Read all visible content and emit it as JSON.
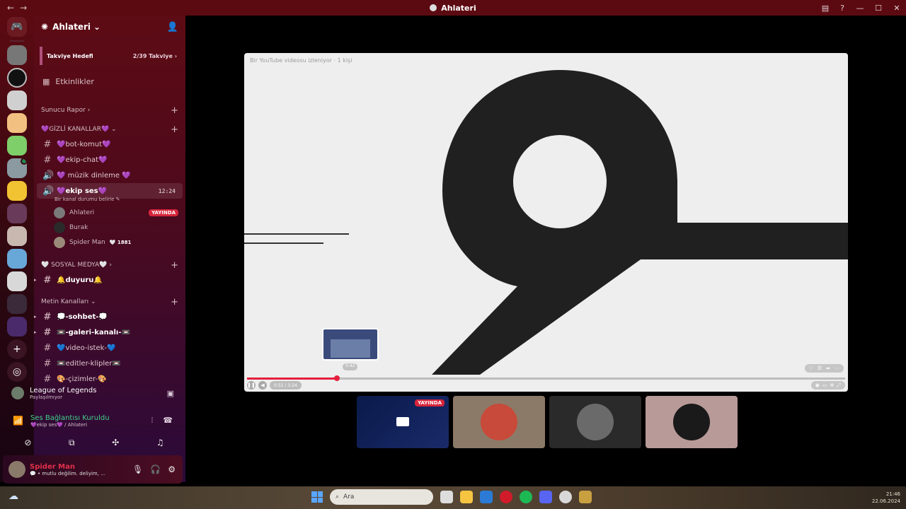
{
  "window": {
    "title": "Ahlateri",
    "back": "←",
    "forward": "→"
  },
  "server": {
    "name": "Ahlateri",
    "boost": {
      "label": "Takviye Hedefi",
      "count": "2/39 Takviye ›"
    },
    "events_label": "Etkinlikler",
    "categories": {
      "report": "Sunucu Rapor ›",
      "hidden": "💜GİZLİ KANALLAR💜 ⌄",
      "social": "🤍 SOSYAL MEDYA🤍 ›",
      "text": "Metin Kanalları ⌄"
    },
    "hidden_channels": [
      {
        "icon": "#",
        "label": "💜bot-komut💜"
      },
      {
        "icon": "#",
        "label": "💜ekip-chat💜"
      },
      {
        "icon": "🔊",
        "label": "💜 müzik dinleme 💜"
      }
    ],
    "active_voice": {
      "label": "💜ekip ses💜",
      "time": "12:24",
      "status": "Bir kanal durumu belirle ✎"
    },
    "voice_users": [
      {
        "name": "Ahlateri",
        "badge": "YAYINDA"
      },
      {
        "name": "Burak",
        "badge": ""
      },
      {
        "name": "Spider Man",
        "badge": "🤍 1881"
      }
    ],
    "social_channels": [
      {
        "label": "🔔duyuru🔔"
      }
    ],
    "text_channels": [
      {
        "label": "💭-sohbet-💭"
      },
      {
        "label": "📼-galeri-kanalı-📼"
      },
      {
        "label": "💙video-istek-💙"
      },
      {
        "label": "📼editler-klipler📼"
      },
      {
        "label": "🎨-çizimler-🎨"
      }
    ]
  },
  "activity": {
    "game": "League of Legends",
    "sub": "Paylaşılmıyor"
  },
  "voice_status": {
    "title": "Ses Bağlantısı Kuruldu",
    "sub": "💜ekip ses💜 / Ahlateri"
  },
  "user": {
    "name": "Spider Man",
    "status": "💬 • mutlu değilim. deliyim, ..."
  },
  "stream": {
    "caption": "Bir YouTube videosu izleniyor · 1 kişi",
    "thumb_time": "0:42",
    "current_time": "0:51 / 3:24",
    "progress_pct": 15,
    "tiles_live": "YAYINDA"
  },
  "taskbar": {
    "search_placeholder": "Ara",
    "time": "21:46",
    "date": "22.06.2024"
  },
  "colors": {
    "accent": "#e61e3c",
    "live": "#d6253c",
    "voice_green": "#3ed188"
  }
}
